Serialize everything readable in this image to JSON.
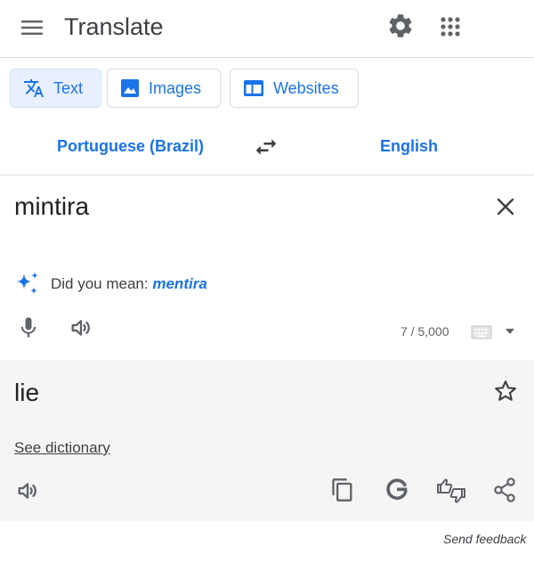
{
  "header": {
    "title": "Translate",
    "menu_icon": "hamburger-menu-icon",
    "settings_icon": "gear-icon",
    "apps_icon": "apps-grid-icon"
  },
  "tabs": [
    {
      "label": "Text",
      "icon": "translate-icon",
      "active": true
    },
    {
      "label": "Images",
      "icon": "image-icon",
      "active": false
    },
    {
      "label": "Websites",
      "icon": "website-icon",
      "active": false
    }
  ],
  "languages": {
    "source": "Portuguese (Brazil)",
    "target": "English",
    "swap_icon": "swap-arrows-icon"
  },
  "source": {
    "text": "mintira",
    "did_you_mean_prefix": "Did you mean:",
    "suggestion": "mentira",
    "char_count": "7 / 5,000"
  },
  "target": {
    "text": "lie",
    "dictionary_link": "See dictionary"
  },
  "footer": {
    "feedback": "Send feedback"
  },
  "colors": {
    "accent": "#1a73e8",
    "text": "#202124",
    "icon": "#5f6368",
    "panel": "#f5f5f5"
  }
}
